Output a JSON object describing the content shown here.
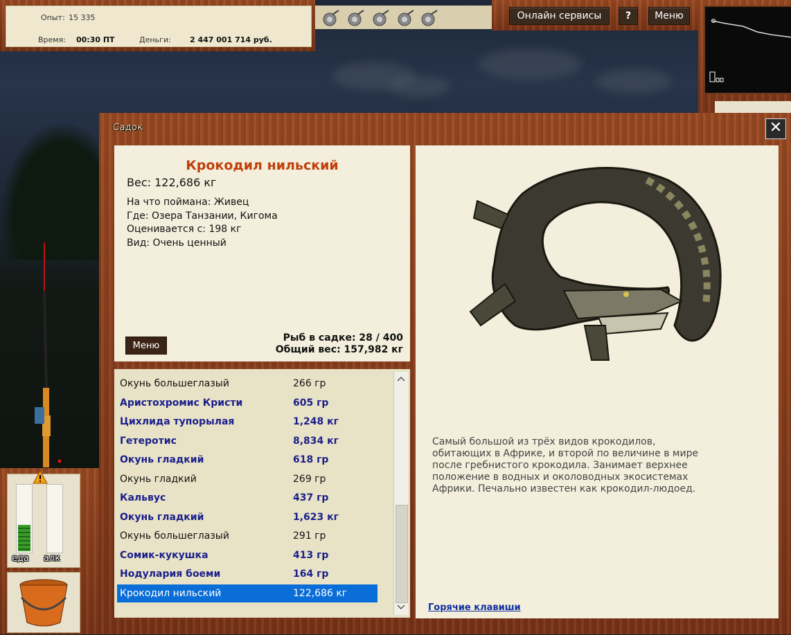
{
  "hud": {
    "exp_label": "Опыт:",
    "exp_value": "15 335",
    "time_label": "Время:",
    "time_value": "00:30 ПТ",
    "money_label": "Деньги:",
    "money_value": "2 447 001 714 руб."
  },
  "topbar": {
    "online_services": "Онлайн сервисы",
    "help": "?",
    "menu": "Меню"
  },
  "gauges": {
    "food_label": "еда",
    "alc_label": "алк",
    "food_level": 0.4,
    "alc_level": 0.0
  },
  "dialog": {
    "title": "Садок",
    "close": "✕"
  },
  "fish_card": {
    "name": "Крокодил нильский",
    "weight": "Вес: 122,686 кг",
    "bait": "На что поймана: Живец",
    "location": "Где: Озера Танзании, Кигома",
    "rated_from": "Оценивается с: 198 кг",
    "kind": "Вид: Очень ценный",
    "menu_button": "Меню",
    "count": "Рыб в садке: 28 / 400",
    "total_weight": "Общий вес: 157,982 кг"
  },
  "fish_list": [
    {
      "name": "Окунь большеглазый",
      "weight": "266 гр",
      "bold": false
    },
    {
      "name": "Аристохромис Кристи",
      "weight": "605 гр",
      "bold": true
    },
    {
      "name": "Цихлида тупорылая",
      "weight": "1,248 кг",
      "bold": true
    },
    {
      "name": "Гетеротис",
      "weight": "8,834 кг",
      "bold": true
    },
    {
      "name": "Окунь гладкий",
      "weight": "618 гр",
      "bold": true
    },
    {
      "name": "Окунь гладкий",
      "weight": "269 гр",
      "bold": false
    },
    {
      "name": "Кальвус",
      "weight": "437 гр",
      "bold": true
    },
    {
      "name": "Окунь гладкий",
      "weight": "1,623 кг",
      "bold": true
    },
    {
      "name": "Окунь большеглазый",
      "weight": "291 гр",
      "bold": false
    },
    {
      "name": "Сомик-кукушка",
      "weight": "413 гр",
      "bold": true
    },
    {
      "name": "Нодулария боеми",
      "weight": "164 гр",
      "bold": true
    },
    {
      "name": "Крокодил нильский",
      "weight": "122,686 кг",
      "bold": false,
      "selected": true
    }
  ],
  "description": {
    "lines": [
      "Самый большой из трёх видов крокодилов,",
      "обитающих в Африке, и второй по величине в мире",
      "после гребнистого крокодила. Занимает верхнее",
      "положение в водных и околоводных экосистемах",
      "Африки. Печально известен как крокодил-людоед."
    ],
    "hotkeys": "Горячие клавиши"
  },
  "colors": {
    "wood": "#8a3f1d",
    "panel": "#f3efdc",
    "fish_title": "#c0400c",
    "bold_row": "#1a1f8c",
    "selected_row": "#0a6ed8"
  }
}
